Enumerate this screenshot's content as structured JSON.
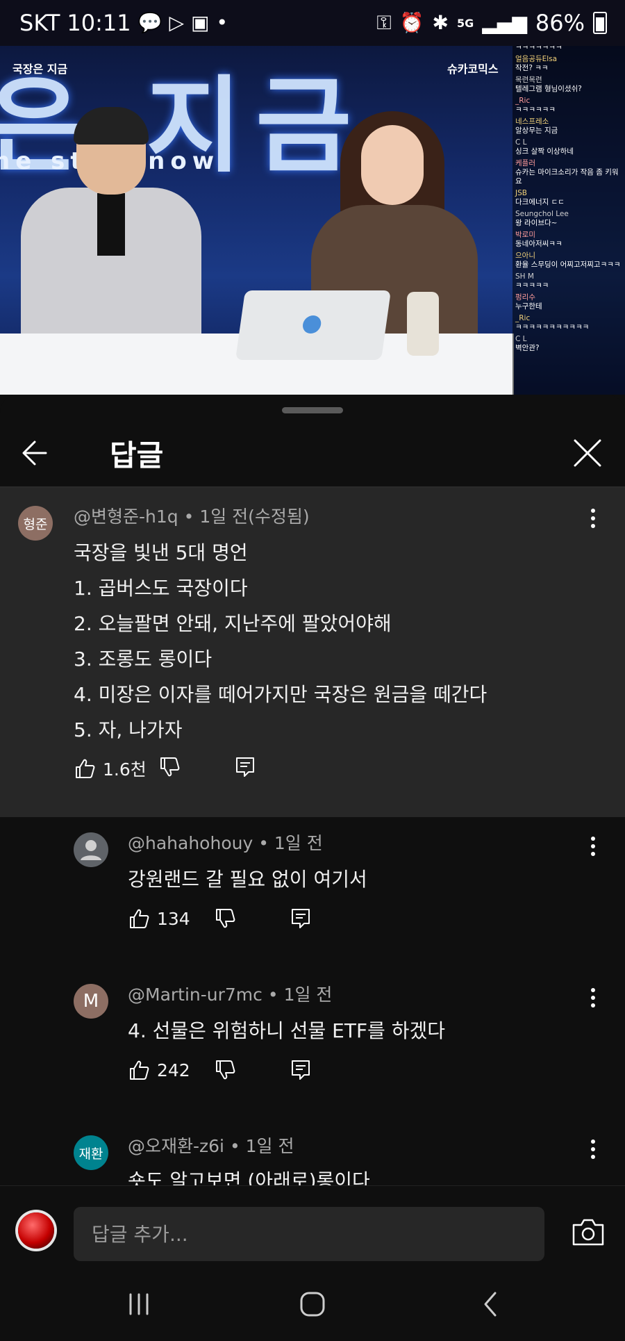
{
  "status_bar": {
    "carrier": "SKT",
    "time": "10:11",
    "network": "5G",
    "battery": "86%"
  },
  "video": {
    "title_overlay": "은 지금",
    "subtitle_overlay": "he st  is now",
    "logo_left": "국장은 지금",
    "logo_right": "슈카코믹스",
    "chat": [
      {
        "author": "",
        "text": "ㅋㅋㅋㅋㅋㅋㅋ"
      },
      {
        "author": "얼음공듀Elsa",
        "text": "작전? ㅋㅋ"
      },
      {
        "author": "목련목련",
        "text": "텔레그램 형님이셨쉬?"
      },
      {
        "author": "_Ric",
        "text": "ㅋㅋㅋㅋㅋㅋ"
      },
      {
        "author": "네스프레소",
        "text": "알상무는 지금"
      },
      {
        "author": "C L",
        "text": "싱크 살짝 이상하네"
      },
      {
        "author": "케플러",
        "text": "슈카는 마이크소리가 작음 좀 키워요"
      },
      {
        "author": "JSB",
        "text": "다크에너지 ㄷㄷ"
      },
      {
        "author": "Seungchol Lee",
        "text": "왕 라이브다~"
      },
      {
        "author": "박로미",
        "text": "동네아저씨ㅋㅋ"
      },
      {
        "author": "으아니",
        "text": "환율 스무딩이 어찌고저찌고ㅋㅋㅋ"
      },
      {
        "author": "SH M",
        "text": "ㅋㅋㅋㅋㅋ"
      },
      {
        "author": "펑리수",
        "text": "누구한테"
      },
      {
        "author": "_Ric",
        "text": "ㅋㅋㅋㅋㅋㅋㅋㅋㅋㅋㅋ"
      },
      {
        "author": "C L",
        "text": "벽안관?"
      }
    ]
  },
  "sheet": {
    "title": "답글",
    "icons": {
      "back": "arrow-left-icon",
      "close": "close-icon"
    }
  },
  "parent_comment": {
    "avatar_text": "형준",
    "avatar_color": "#8d6e63",
    "author": "@변형준-h1q",
    "time": "1일 전(수정됨)",
    "lines": [
      "국장을 빛낸 5대 명언",
      "1. 곱버스도 국장이다",
      "2. 오늘팔면 안돼, 지난주에 팔았어야해",
      "3. 조롱도 롱이다",
      "4. 미장은 이자를 떼어가지만 국장은 원금을 떼간다",
      "5. 자, 나가자"
    ],
    "likes": "1.6천"
  },
  "replies": [
    {
      "avatar_text": "",
      "avatar_color": "#5f6368",
      "author": "@hahahohouy",
      "time": "1일 전",
      "text": "강원랜드 갈 필요 없이 여기서",
      "likes": "134"
    },
    {
      "avatar_text": "M",
      "avatar_color": "#8d6e63",
      "author": "@Martin-ur7mc",
      "time": "1일 전",
      "text": "4. 선물은 위험하니 선물 ETF를 하겠다",
      "likes": "242"
    },
    {
      "avatar_text": "재환",
      "avatar_color": "#00838f",
      "author": "@오재환-z6i",
      "time": "1일 전",
      "text": "숏도 알고보면 (아래로)롱이다",
      "likes": ""
    }
  ],
  "input": {
    "placeholder": "답글 추가..."
  },
  "colors": {
    "background": "#0f0f0f",
    "parent_background": "#272727",
    "meta_text": "#aaaaaa"
  }
}
